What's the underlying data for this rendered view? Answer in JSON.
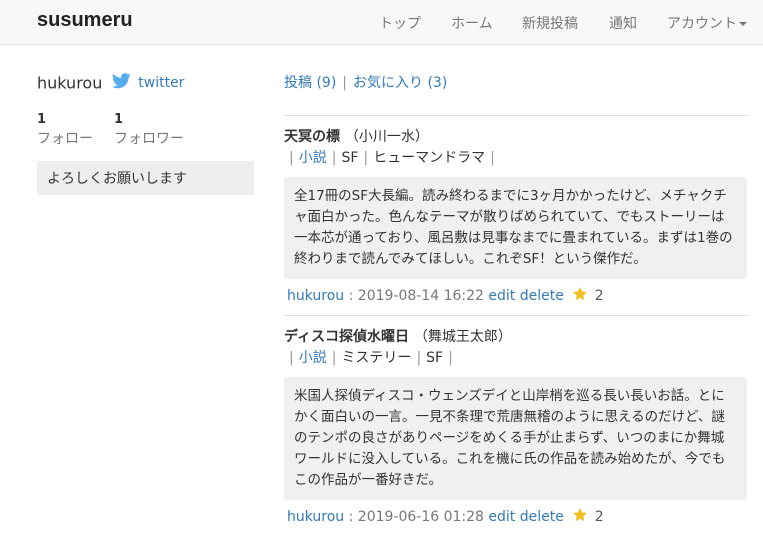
{
  "navbar": {
    "brand": "susumeru",
    "items": [
      "トップ",
      "ホーム",
      "新規投稿",
      "通知",
      "アカウント"
    ]
  },
  "profile": {
    "username": "hukurou",
    "twitter_label": "twitter",
    "follow_count": "1",
    "follow_label": "フォロー",
    "follower_count": "1",
    "follower_label": "フォロワー",
    "bio": "よろしくお願いします"
  },
  "tabs": {
    "posts": "投稿 (9)",
    "separator": "|",
    "favorites": "お気に入り (3)"
  },
  "posts": [
    {
      "title": "天冥の標",
      "author": "（小川一水）",
      "tags": [
        {
          "label": "小説",
          "link": true
        },
        {
          "label": "SF",
          "link": false
        },
        {
          "label": "ヒューマンドラマ",
          "link": false
        }
      ],
      "body": "全17冊のSF大長編。読み終わるまでに3ヶ月かかったけど、メチャクチャ面白かった。色んなテーマが散りばめられていて、でもストーリーは一本芯が通っており、風呂敷は見事なまでに畳まれている。まずは1巻の終わりまで読んでみてほしい。これぞSF！という傑作だ。",
      "user": "hukurou",
      "date": ": 2019-08-14 16:22",
      "edit": "edit",
      "delete": "delete",
      "likes": "2"
    },
    {
      "title": "ディスコ探偵水曜日",
      "author": "（舞城王太郎）",
      "tags": [
        {
          "label": "小説",
          "link": true
        },
        {
          "label": "ミステリー",
          "link": false
        },
        {
          "label": "SF",
          "link": false
        }
      ],
      "body": "米国人探偵ディスコ・ウェンズデイと山岸梢を巡る長い長いお話。とにかく面白いの一言。一見不条理で荒唐無稽のように思えるのだけど、謎のテンポの良さがありページをめくる手が止まらず、いつのまにか舞城ワールドに没入している。これを機に氏の作品を読み始めたが、今でもこの作品が一番好きだ。",
      "user": "hukurou",
      "date": ": 2019-06-16 01:28",
      "edit": "edit",
      "delete": "delete",
      "likes": "2"
    }
  ],
  "icons": {
    "twitter": "twitter-bird-icon",
    "star": "star-icon",
    "caret": "caret-down-icon"
  },
  "colors": {
    "link": "#337ab7",
    "navbar_bg": "#f8f8f8",
    "body_box": "#f0f0f0",
    "twitter": "#55acee",
    "star": "#f0c020"
  }
}
